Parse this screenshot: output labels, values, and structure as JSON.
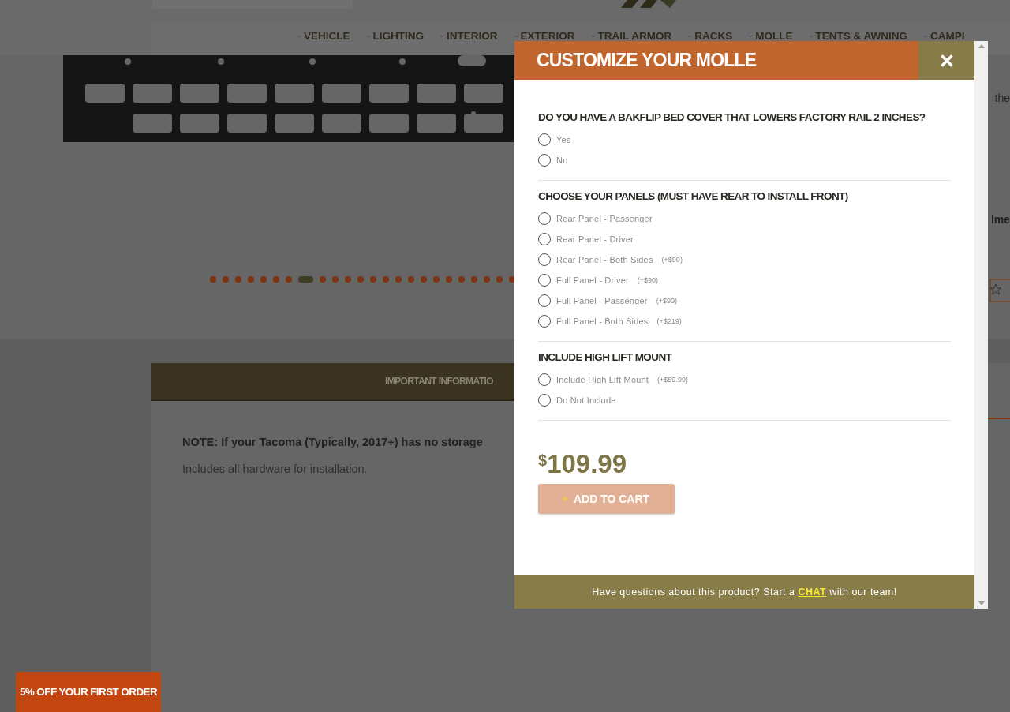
{
  "header": {
    "nav": [
      {
        "label": "VEHICLE"
      },
      {
        "label": "LIGHTING"
      },
      {
        "label": "INTERIOR"
      },
      {
        "label": "EXTERIOR"
      },
      {
        "label": "TRAIL ARMOR"
      },
      {
        "label": "RACKS"
      },
      {
        "label": "MOLLE"
      },
      {
        "label": "TENTS & AWNING"
      },
      {
        "label": "CAMPI"
      }
    ]
  },
  "hero": {
    "side_texts": [
      "the",
      "lme"
    ],
    "carousel_dots": [
      {
        "selected": false
      },
      {
        "selected": false
      },
      {
        "selected": false
      },
      {
        "selected": false
      },
      {
        "selected": false
      },
      {
        "selected": false
      },
      {
        "selected": false
      },
      {
        "selected": true
      },
      {
        "selected": false
      },
      {
        "selected": false
      },
      {
        "selected": false
      },
      {
        "selected": false
      },
      {
        "selected": false
      },
      {
        "selected": false
      },
      {
        "selected": false
      },
      {
        "selected": false
      },
      {
        "selected": false
      },
      {
        "selected": false
      },
      {
        "selected": false
      },
      {
        "selected": false
      },
      {
        "selected": false
      },
      {
        "selected": false
      },
      {
        "selected": false
      },
      {
        "selected": false
      }
    ]
  },
  "details": {
    "tabs": [
      {
        "label": "IMPORTANT INFORMATIO",
        "selected": true
      }
    ],
    "note": "NOTE: If your Tacoma (Typically, 2017+) has no storage",
    "text": "Includes all hardware for installation."
  },
  "modal": {
    "title": "CUSTOMIZE YOUR MOLLE",
    "groups": [
      {
        "question": "DO YOU HAVE A BAKFLIP BED COVER THAT LOWERS FACTORY RAIL 2 INCHES?",
        "options": [
          {
            "label": "Yes",
            "selected": false
          },
          {
            "label": "No",
            "selected": false
          }
        ]
      },
      {
        "question": "CHOOSE YOUR PANELS (MUST HAVE REAR TO INSTALL FRONT)",
        "options": [
          {
            "label": "Rear Panel - Passenger",
            "selected": false
          },
          {
            "label": "Rear Panel - Driver",
            "selected": false
          },
          {
            "label": "Rear Panel - Both Sides",
            "price": "(+$90)",
            "selected": false
          },
          {
            "label": "Full Panel - Driver",
            "price": "(+$90)",
            "selected": false
          },
          {
            "label": "Full Panel - Passenger",
            "price": "(+$90)",
            "selected": false
          },
          {
            "label": "Full Panel - Both Sides",
            "price": "(+$219)",
            "selected": false
          }
        ]
      },
      {
        "question": "INCLUDE HIGH LIFT MOUNT",
        "options": [
          {
            "label": "Include High Lift Mount",
            "price": "(+$59.99)",
            "selected": false
          },
          {
            "label": "Do Not Include",
            "selected": false
          }
        ]
      }
    ],
    "price": {
      "currency": "$",
      "amount": "109.99"
    },
    "add_to_cart": "ADD TO CART",
    "footer": {
      "before": "Have questions about this product? Start a",
      "link": "CHAT",
      "after": "with our team!"
    }
  },
  "promo": "5% OFF YOUR FIRST ORDER"
}
